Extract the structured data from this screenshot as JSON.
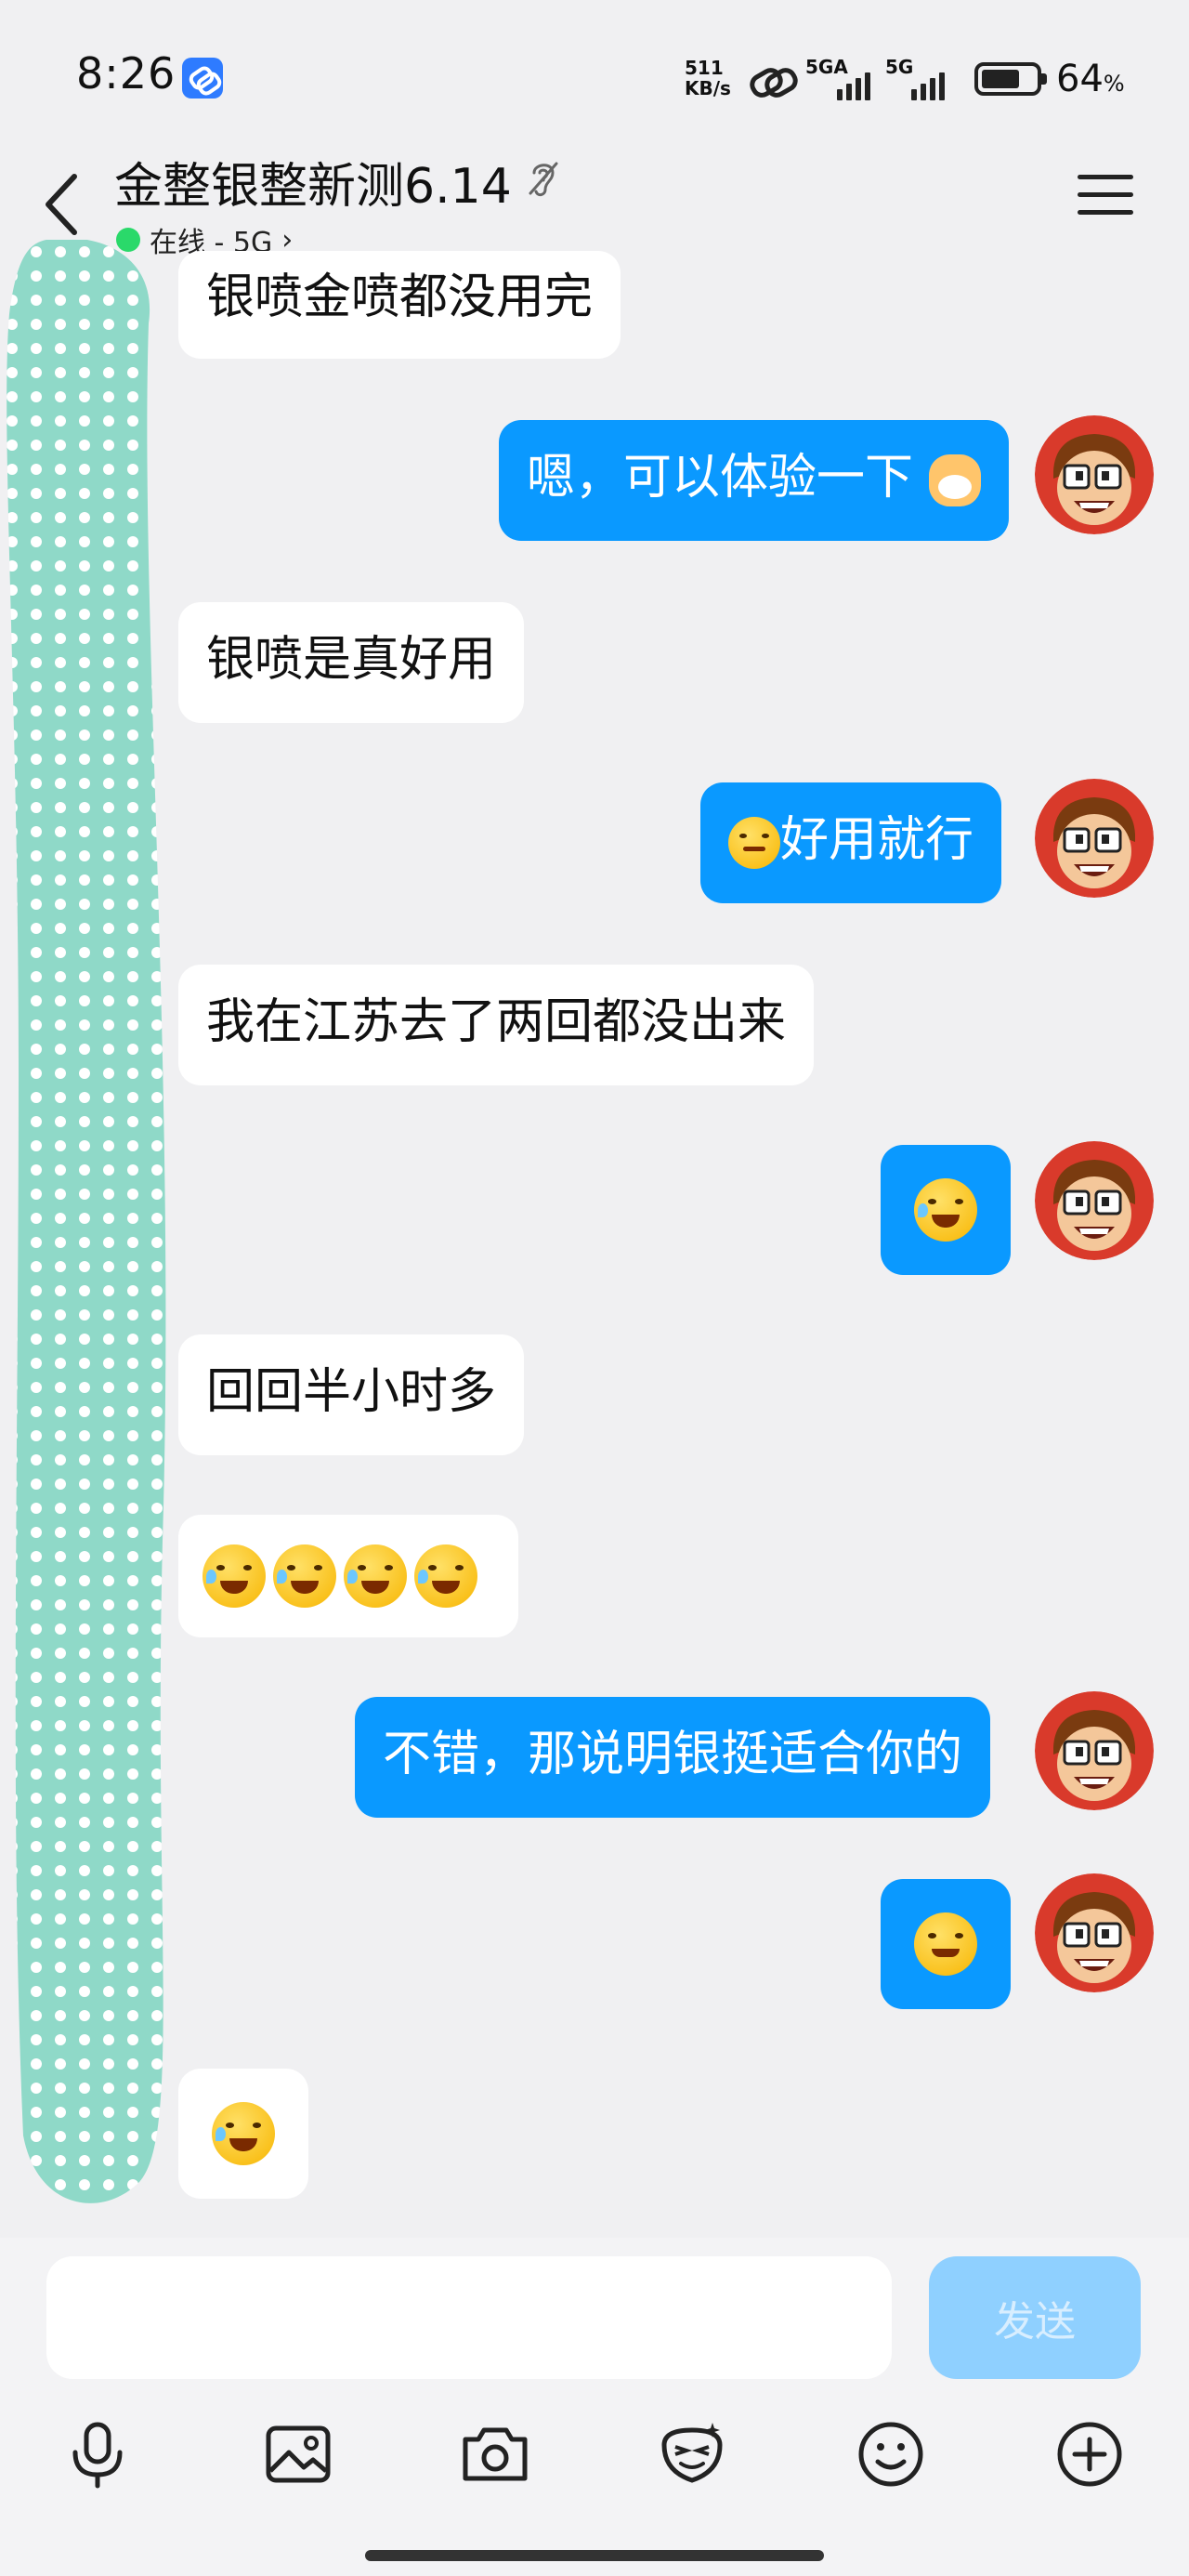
{
  "status_bar": {
    "time": "8:26",
    "net_speed_value": "511",
    "net_speed_unit": "KB/s",
    "sim1_label": "5GA",
    "sim2_label": "5G",
    "battery_percent": "64",
    "battery_unit": "%"
  },
  "header": {
    "title": "金整银整新测6.14",
    "status": "在线 - 5G",
    "chevron": "›"
  },
  "messages": [
    {
      "side": "in",
      "text": "银喷金喷都没用完"
    },
    {
      "side": "out",
      "text": "嗯，可以体验一下"
    },
    {
      "side": "in",
      "text": "银喷是真好用"
    },
    {
      "side": "out",
      "text": "好用就行"
    },
    {
      "side": "in",
      "text": "我在江苏去了两回都没出来"
    },
    {
      "side": "out",
      "text": ""
    },
    {
      "side": "in",
      "text": "回回半小时多"
    },
    {
      "side": "in",
      "text": ""
    },
    {
      "side": "out",
      "text": "不错，那说明银挺适合你的"
    },
    {
      "side": "out",
      "text": ""
    },
    {
      "side": "in",
      "text": ""
    }
  ],
  "input": {
    "placeholder": "",
    "send_label": "发送"
  },
  "colors": {
    "outgoing_bubble": "#0a99ff",
    "incoming_bubble": "#ffffff",
    "online_dot": "#2ad96a",
    "send_disabled": "#8fd0ff",
    "censor": "#8fd9c8"
  },
  "icons": {
    "toolbar": [
      "microphone-icon",
      "image-icon",
      "camera-icon",
      "sticker-icon",
      "emoji-icon",
      "plus-icon"
    ]
  }
}
